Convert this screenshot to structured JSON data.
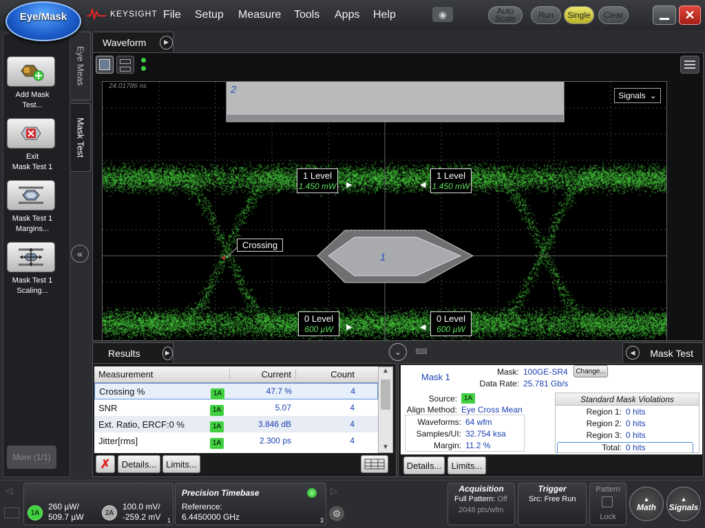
{
  "app": {
    "button_label": "Eye/Mask",
    "brand": "KEYSIGHT"
  },
  "menu": [
    "File",
    "Setup",
    "Measure",
    "Tools",
    "Apps",
    "Help"
  ],
  "toolbar": {
    "auto_scale_l1": "Auto",
    "auto_scale_l2": "Scale",
    "run": "Run",
    "single": "Single",
    "clear": "Clear"
  },
  "left_panel": {
    "tiles": [
      {
        "l1": "Add Mask",
        "l2": "Test..."
      },
      {
        "l1": "Exit",
        "l2": "Mask Test 1"
      },
      {
        "l1": "Mask Test 1",
        "l2": "Margins..."
      },
      {
        "l1": "Mask Test 1",
        "l2": "Scaling..."
      }
    ],
    "more": "More (1/1)",
    "tabs": {
      "eye_meas": "Eye Meas",
      "mask_test": "Mask Test"
    }
  },
  "waveform": {
    "tab": "Waveform",
    "timestamp": "24.01786 ns",
    "signals_dropdown": "Signals",
    "mask_region_1": "1",
    "mask_region_2": "2",
    "crossing_label": "Crossing",
    "level_1": {
      "label": "1 Level",
      "value": "1.450 mW"
    },
    "level_0": {
      "label": "0 Level",
      "value": "600 µW"
    }
  },
  "results": {
    "tab": "Results",
    "headers": {
      "measurement": "Measurement",
      "current": "Current",
      "count": "Count"
    },
    "rows": [
      {
        "name": "Crossing %",
        "source": "1A",
        "current": "47.7 %",
        "count": "4"
      },
      {
        "name": "SNR",
        "source": "1A",
        "current": "5.07",
        "count": "4"
      },
      {
        "name": "Ext. Ratio, ERCF:0 %",
        "source": "1A",
        "current": "3.846 dB",
        "count": "4"
      },
      {
        "name": "Jitter[rms]",
        "source": "1A",
        "current": "2.300 ps",
        "count": "4"
      }
    ],
    "details": "Details...",
    "limits": "Limits..."
  },
  "mask_test": {
    "tab": "Mask Test",
    "mask_name": "Mask 1",
    "mask_label": "Mask:",
    "mask_value": "100GE-SR4",
    "change": "Change...",
    "data_rate_label": "Data Rate:",
    "data_rate_value": "25.781 Gb/s",
    "source_label": "Source:",
    "source_value": "1A",
    "align_label": "Align Method:",
    "align_value": "Eye Cross Mean",
    "waveforms_label": "Waveforms:",
    "waveforms_value": "64 wfm",
    "samples_label": "Samples/UI:",
    "samples_value": "32.754 ksa",
    "margin_label": "Margin:",
    "margin_value": "11.2 %",
    "violations_title": "Standard Mask Violations",
    "regions": [
      {
        "label": "Region 1:",
        "value": "0 hits"
      },
      {
        "label": "Region 2:",
        "value": "0 hits"
      },
      {
        "label": "Region 3:",
        "value": "0 hits"
      }
    ],
    "total_label": "Total:",
    "total_value": "0 hits",
    "details": "Details...",
    "limits": "Limits..."
  },
  "status": {
    "ch1_badge": "1A",
    "ch1_l1": "260 µW/",
    "ch1_l2": "509.7 µW",
    "ch2_badge": "2A",
    "ch2_l1": "100.0 mV/",
    "ch2_l2": "-259.2 mV",
    "ch_index": "1",
    "timebase_title": "Precision Timebase",
    "timebase_ref_label": "Reference:",
    "timebase_ref_value": "6.4450000 GHz",
    "timebase_index": "3",
    "acq_title": "Acquisition",
    "acq_l1": "Full Pattern:",
    "acq_l1_val": "Off",
    "acq_l2": "2048 pts/wfm",
    "trig_title": "Trigger",
    "trig_l1": "Src:",
    "trig_l1_val": "Free Run",
    "pattern": "Pattern",
    "lock": "Lock",
    "math": "Math",
    "signals": "Signals"
  },
  "colors": {
    "accent_green": "#3fcf3f",
    "single_yellow": "#e0dc55",
    "close_red": "#c0322a",
    "link_blue": "#1a3fb0"
  }
}
